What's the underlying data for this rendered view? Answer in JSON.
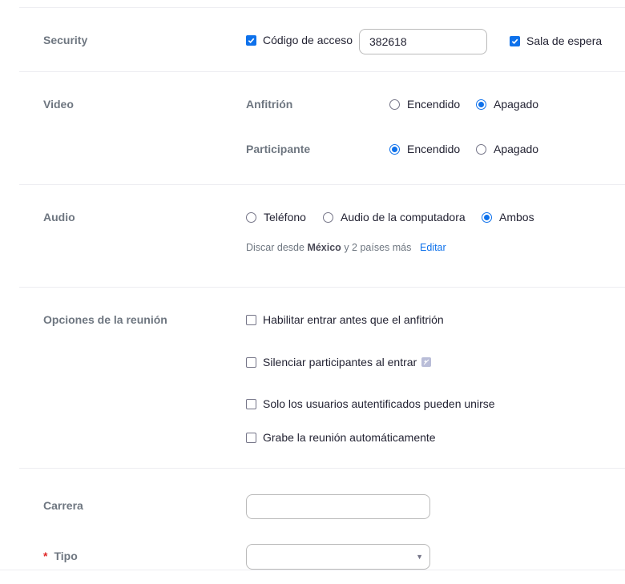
{
  "security": {
    "label": "Security",
    "passcode_label": "Código de acceso",
    "passcode_checked": true,
    "passcode_value": "382618",
    "waiting_room_label": "Sala de espera",
    "waiting_room_checked": true
  },
  "video": {
    "label": "Video",
    "host_label": "Anfitrión",
    "participant_label": "Participante",
    "on_label": "Encendido",
    "off_label": "Apagado",
    "host_value": "Apagado",
    "participant_value": "Encendido"
  },
  "audio": {
    "label": "Audio",
    "options": [
      "Teléfono",
      "Audio de la computadora",
      "Ambos"
    ],
    "selected": "Ambos",
    "dial_prefix": "Discar desde",
    "dial_country": "México",
    "dial_suffix": "y 2 países más",
    "edit_label": "Editar"
  },
  "meeting_options": {
    "label": "Opciones de la reunión",
    "items": [
      {
        "label": "Habilitar entrar antes que el anfitrión",
        "checked": false
      },
      {
        "label": "Silenciar participantes al entrar",
        "checked": false,
        "help_icon": "info-icon"
      },
      {
        "label": "Solo los usuarios autentificados pueden unirse",
        "checked": false
      },
      {
        "label": "Grabe la reunión automáticamente",
        "checked": false
      }
    ]
  },
  "carrera": {
    "label": "Carrera",
    "value": ""
  },
  "tipo": {
    "required_mark": "*",
    "label": "Tipo",
    "value": ""
  },
  "colors": {
    "accent": "#0e71eb",
    "label": "#6e7680",
    "text": "#232333",
    "required": "#e02828"
  }
}
